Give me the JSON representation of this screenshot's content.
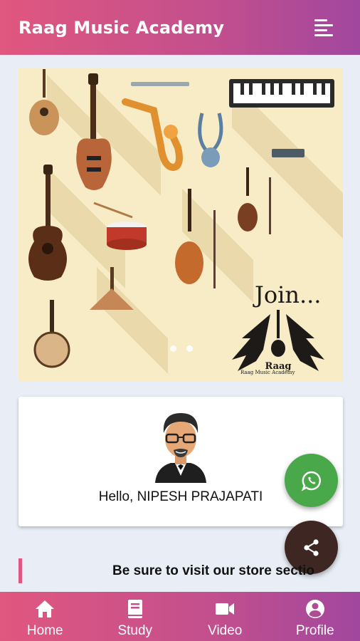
{
  "app": {
    "title": "Raag Music Academy"
  },
  "banner": {
    "join_text": "Join...",
    "logo_caption": "Raag Music Academy",
    "slides": 2,
    "active_slide": 1
  },
  "profile": {
    "greeting": "Hello, NIPESH PRAJAPATI"
  },
  "store": {
    "message": "Be sure to visit our store sectio"
  },
  "fabs": {
    "whatsapp_icon": "whatsapp-icon",
    "share_icon": "share-icon"
  },
  "bottom_nav": {
    "items": [
      {
        "label": "Home",
        "icon": "home-icon"
      },
      {
        "label": "Study",
        "icon": "book-icon"
      },
      {
        "label": "Video",
        "icon": "video-camera-icon"
      },
      {
        "label": "Profile",
        "icon": "account-circle-icon"
      }
    ]
  },
  "colors": {
    "accent_pink": "#e0577f",
    "accent_purple": "#a1479e",
    "whatsapp_green": "#49a84a",
    "share_brown": "#3e2723"
  }
}
